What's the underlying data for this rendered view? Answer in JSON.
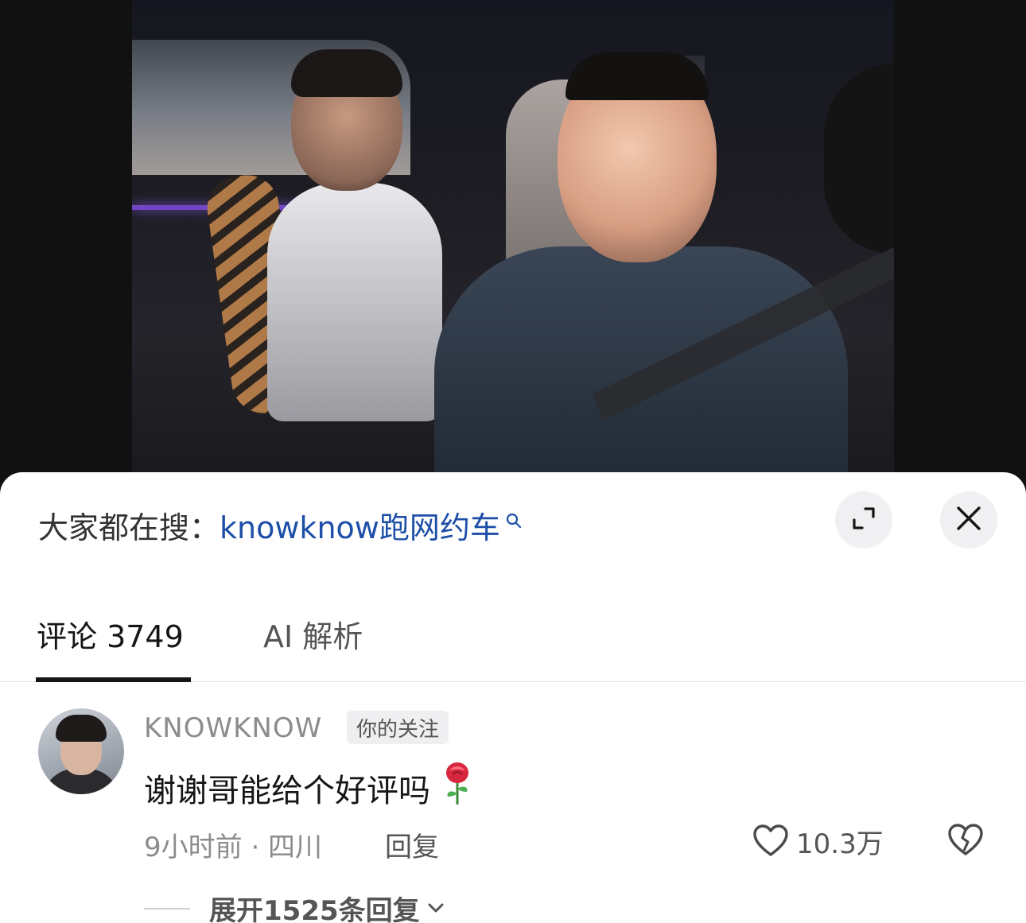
{
  "video": {
    "scene": "two men in a car at night, selfie"
  },
  "search": {
    "prefix": "大家都在搜：",
    "term": "knowknow跑网约车"
  },
  "tabs": [
    {
      "label": "评论 3749",
      "active": true
    },
    {
      "label": "AI 解析",
      "active": false
    }
  ],
  "comment": {
    "username": "KNOWKNOW",
    "badge": "你的关注",
    "text": "谢谢哥能给个好评吗",
    "emoji": "rose",
    "meta": "9小时前 · 四川",
    "reply_label": "回复",
    "likes": "10.3万",
    "expand_label": "展开1525条回复"
  },
  "colors": {
    "link": "#1d4fa8",
    "text_primary": "#161616",
    "text_secondary": "#8c8c8f",
    "sheet_bg": "#ffffff",
    "button_bg": "#f0f0f2"
  },
  "icons": {
    "search_term": "search-icon",
    "expand": "expand-icon",
    "close": "close-icon",
    "like": "heart-icon",
    "dislike": "broken-heart-icon",
    "expand_replies": "chevron-down-icon"
  }
}
